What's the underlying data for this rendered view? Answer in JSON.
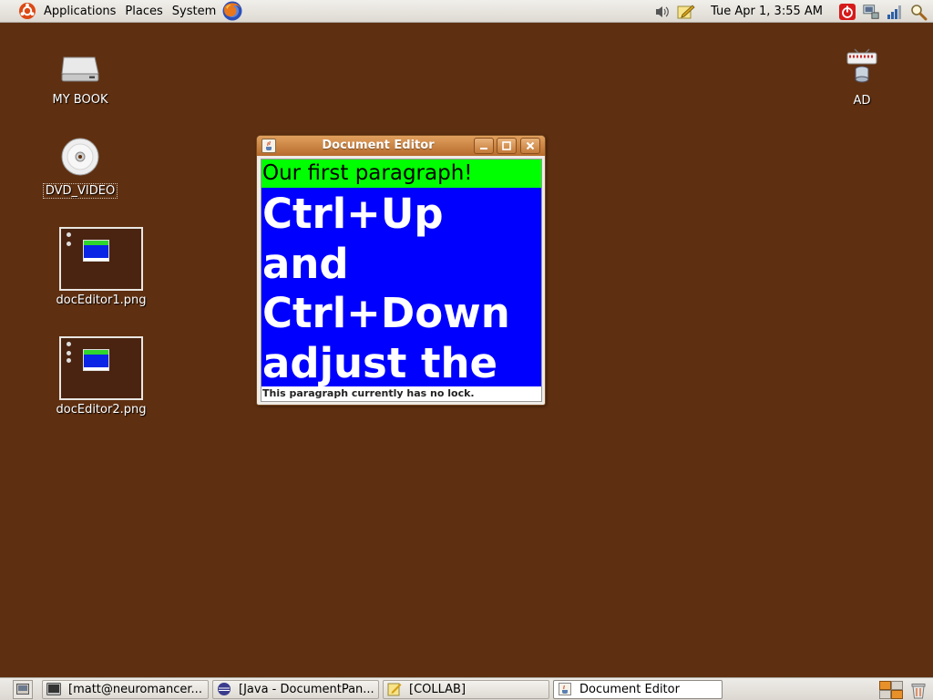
{
  "top_panel": {
    "menus": [
      "Applications",
      "Places",
      "System"
    ],
    "clock": "Tue Apr  1,  3:55 AM"
  },
  "desktop": {
    "icons": [
      {
        "label": "MY BOOK",
        "icon": "drive-icon"
      },
      {
        "label": "DVD_VIDEO",
        "icon": "dvd-icon"
      },
      {
        "label": "docEditor1.png",
        "icon": "image-thumbnail"
      },
      {
        "label": "docEditor2.png",
        "icon": "image-thumbnail"
      },
      {
        "label": "AD",
        "icon": "network-server-icon"
      }
    ]
  },
  "window": {
    "title": "Document Editor",
    "paragraph1": "Our first paragraph!",
    "paragraph2": "Ctrl+Up and Ctrl+Down adjust the header level.",
    "status": "This paragraph currently has no lock.",
    "colors": {
      "paragraph1_bg": "#00ff00",
      "paragraph2_bg": "#0000ff",
      "titlebar": "#c8823f"
    }
  },
  "taskbar": {
    "tasks": [
      {
        "label": "[matt@neuromancer...",
        "icon": "terminal-icon"
      },
      {
        "label": "[Java - DocumentPan...",
        "icon": "eclipse-icon"
      },
      {
        "label": "[COLLAB]",
        "icon": "text-editor-icon"
      },
      {
        "label": "Document Editor",
        "icon": "java-app-icon",
        "active": true
      }
    ]
  },
  "colors": {
    "desktop_background": "#5e2f10",
    "panel": "#e6e3de"
  }
}
